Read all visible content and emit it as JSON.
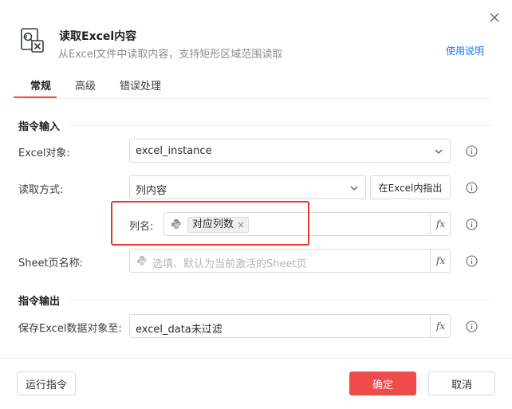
{
  "header": {
    "title": "读取Excel内容",
    "subtitle": "从Excel文件中读取内容，支持矩形区域范围读取",
    "help_link": "使用说明"
  },
  "tabs": [
    {
      "label": "常规",
      "active": true
    },
    {
      "label": "高级",
      "active": false
    },
    {
      "label": "错误处理",
      "active": false
    }
  ],
  "sections": {
    "input_title": "指令输入",
    "output_title": "指令输出"
  },
  "fields": {
    "excel_object": {
      "label": "Excel对象:",
      "value": "excel_instance"
    },
    "read_mode": {
      "label": "读取方式:",
      "value": "列内容",
      "point_button": "在Excel内指出"
    },
    "column_name": {
      "label": "列名:",
      "tag": "对应列数"
    },
    "sheet_name": {
      "label": "Sheet页名称:",
      "placeholder": "选填、默认为当前激活的Sheet页"
    },
    "save_to": {
      "label": "保存Excel数据对象至:",
      "value": "excel_data未过滤"
    }
  },
  "fx_label": "fx",
  "footer": {
    "run_button": "运行指令",
    "confirm_button": "确定",
    "cancel_button": "取消"
  },
  "colors": {
    "accent": "#f04b4b",
    "link": "#1677ff",
    "highlight": "#e53935"
  }
}
